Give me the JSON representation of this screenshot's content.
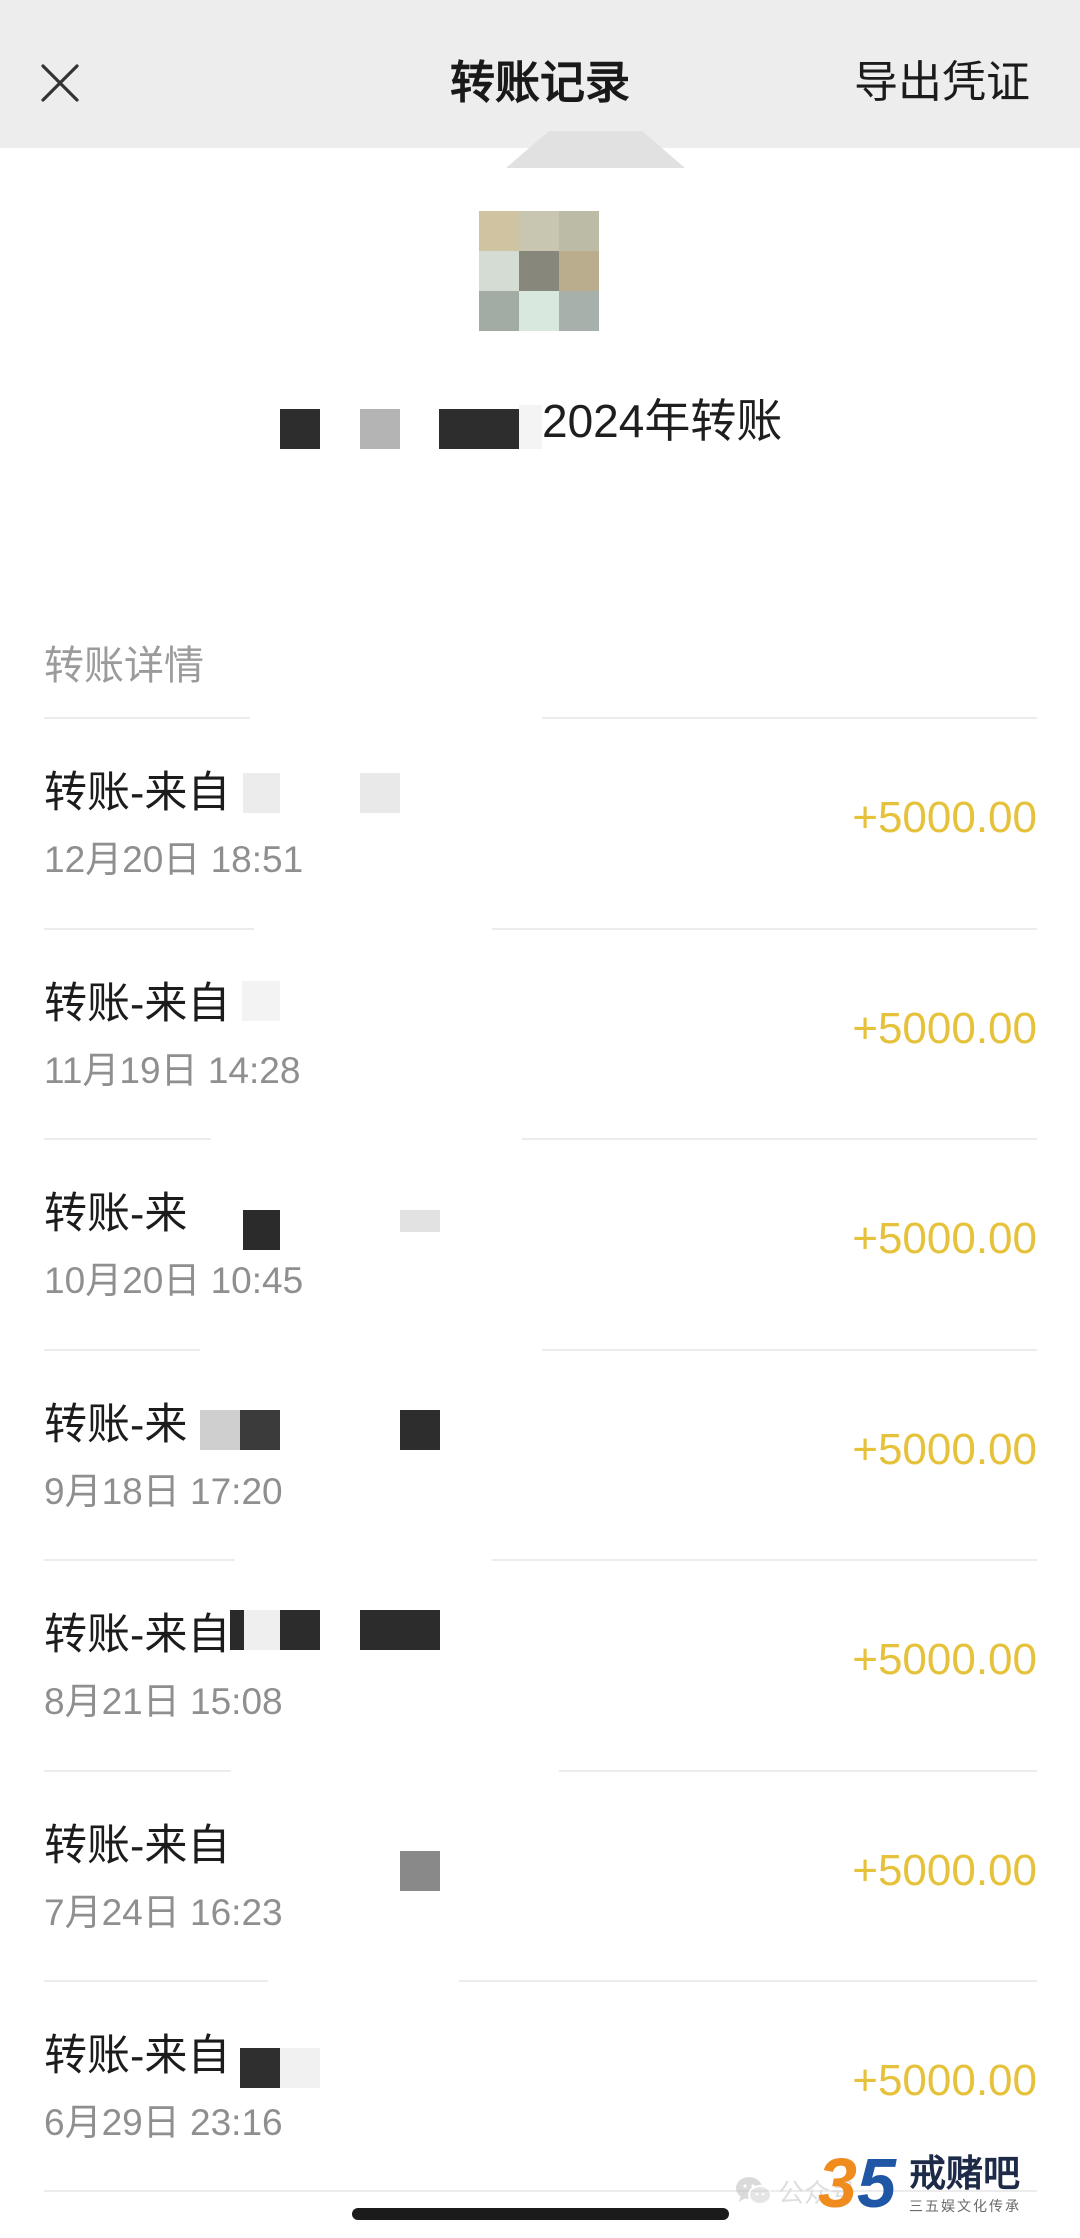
{
  "colors": {
    "header_bg": "#ededed",
    "amount": "#e6c23c",
    "secondary_text": "#8f8f8f",
    "logo_orange": "#f08b1e",
    "logo_blue": "#1f56a5"
  },
  "header": {
    "close_icon": "close-icon",
    "title": "转账记录",
    "export_label": "导出凭证"
  },
  "summary": {
    "avatar_icon": "avatar-mosaic",
    "title": "2024年转账"
  },
  "details": {
    "section_label": "转账详情",
    "items": [
      {
        "title": "转账-来自",
        "time": "12月20日 18:51",
        "amount": "+5000.00"
      },
      {
        "title": "转账-来自",
        "time": "11月19日 14:28",
        "amount": "+5000.00"
      },
      {
        "title": "转账-来",
        "time": "10月20日 10:45",
        "amount": "+5000.00"
      },
      {
        "title": "转账-来",
        "time": "9月18日 17:20",
        "amount": "+5000.00"
      },
      {
        "title": "转账-来自",
        "time": "8月21日 15:08",
        "amount": "+5000.00"
      },
      {
        "title": "转账-来自",
        "time": "7月24日 16:23",
        "amount": "+5000.00"
      },
      {
        "title": "转账-来自",
        "time": "6月29日 23:16",
        "amount": "+5000.00"
      }
    ]
  },
  "watermark": {
    "wechat_icon": "wechat-icon",
    "channel": "公众号",
    "logo_digits": [
      "3",
      "5"
    ],
    "brand": "戒赌吧",
    "tagline": "三五娱文化传承"
  }
}
